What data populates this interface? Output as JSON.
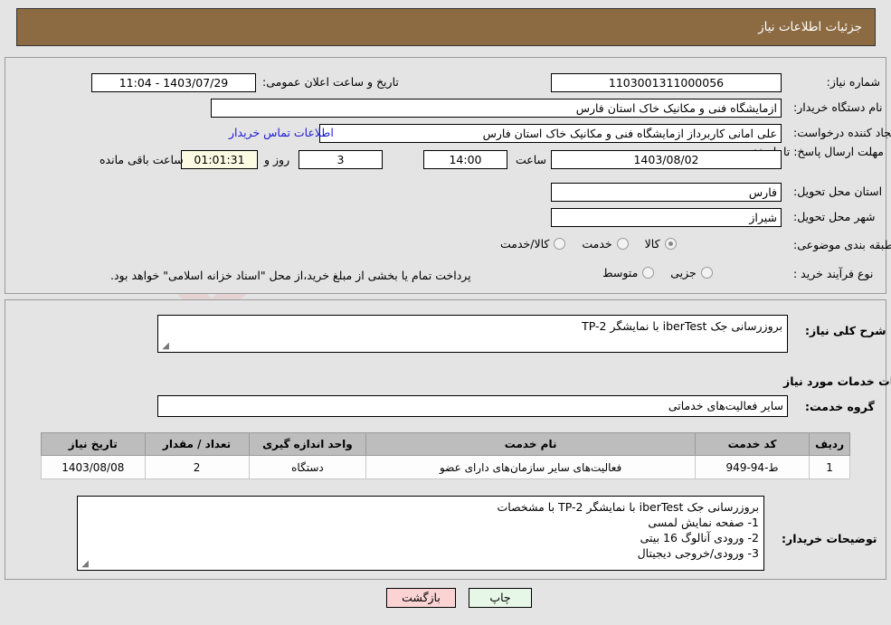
{
  "header": {
    "title": "جزئیات اطلاعات نیاز"
  },
  "top_form": {
    "need_number_label": "شماره نیاز:",
    "need_number_value": "1103001311000056",
    "public_announce_label": "تاریخ و ساعت اعلان عمومی:",
    "public_announce_value": "1403/07/29 - 11:04",
    "buyer_org_label": "نام دستگاه خریدار:",
    "buyer_org_value": "ازمایشگاه فنی و مکانیک خاک استان فارس",
    "requester_label": "ایجاد کننده درخواست:",
    "requester_value": "علی امانی کاربرداز ازمایشگاه فنی و مکانیک خاک استان فارس",
    "contact_link": "اطلاعات تماس خریدار",
    "deadline_label": "مهلت ارسال پاسخ: تا تاریخ:",
    "deadline_date": "1403/08/02",
    "time_label": "ساعت",
    "time_value": "14:00",
    "days_value": "3",
    "days_label": "روز و",
    "countdown_value": "01:01:31",
    "countdown_label": "ساعت باقی مانده",
    "province_label": "استان محل تحویل:",
    "province_value": "فارس",
    "city_label": "شهر محل تحویل:",
    "city_value": "شیراز",
    "category_label": "طبقه بندی موضوعی:",
    "category_options": [
      {
        "label": "کالا",
        "selected": true
      },
      {
        "label": "خدمت",
        "selected": false
      },
      {
        "label": "کالا/خدمت",
        "selected": false
      }
    ],
    "purchase_type_label": "نوع فرآیند خرید :",
    "purchase_type_options": [
      {
        "label": "جزیی",
        "selected": false
      },
      {
        "label": "متوسط",
        "selected": false
      }
    ],
    "treasury_note": "پرداخت تمام یا بخشی از مبلغ خرید،از محل \"اسناد خزانه اسلامی\" خواهد بود."
  },
  "middle": {
    "summary_label": "شرح کلی نیاز:",
    "summary_value": "بروزرسانی جک iberTest با نمایشگر TP-2",
    "services_info_title": "اطلاعات خدمات مورد نیاز",
    "service_group_label": "گروه خدمت:",
    "service_group_value": "سایر فعالیت‌های خدماتی"
  },
  "table": {
    "headers": [
      "ردیف",
      "کد خدمت",
      "نام خدمت",
      "واحد اندازه گیری",
      "تعداد / مقدار",
      "تاریخ نیاز"
    ],
    "rows": [
      {
        "index": "1",
        "service_code": "ط-94-949",
        "service_name": "فعالیت‌های سایر سازمان‌های دارای عضو",
        "unit": "دستگاه",
        "quantity": "2",
        "need_date": "1403/08/08"
      }
    ]
  },
  "buyer_notes": {
    "label": "توضیحات خریدار:",
    "lines": [
      "بروزرسانی جک iberTest با نمایشگر TP-2 با مشخصات",
      "1- صفحه نمایش لمسی",
      "2- ورودی آنالوگ 16 بیتی",
      "3- ورودی/خروجی دیجیتال"
    ]
  },
  "footer": {
    "print_label": "چاپ",
    "back_label": "بازگشت"
  },
  "watermark": {
    "text": "AriaTender.net"
  }
}
